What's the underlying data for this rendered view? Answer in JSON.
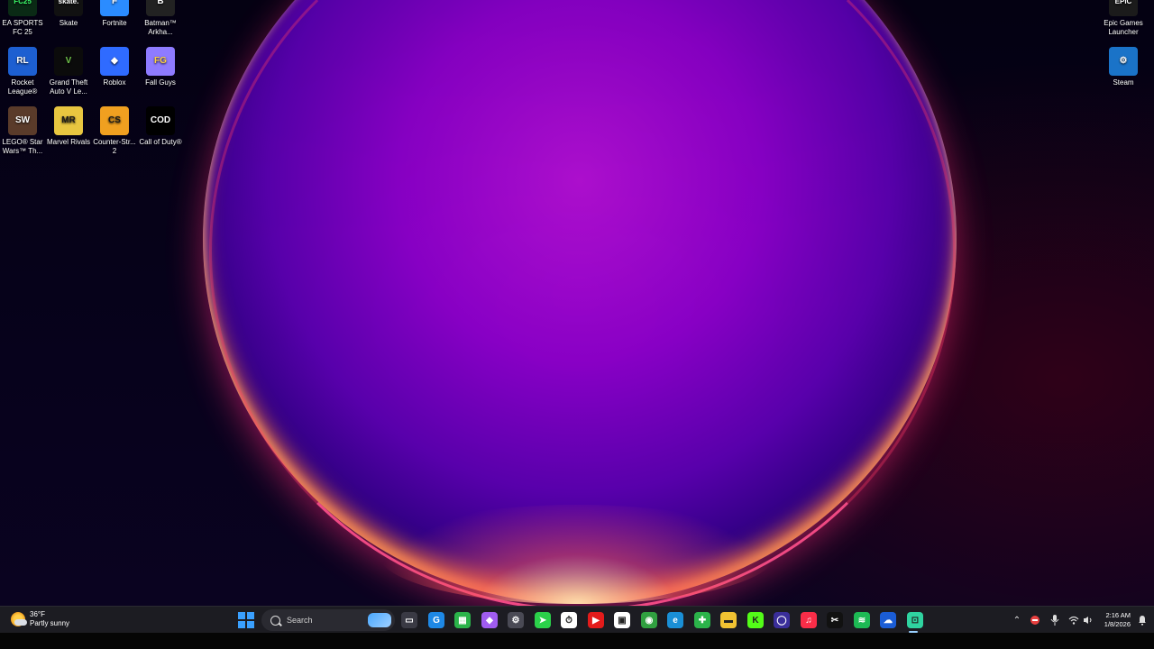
{
  "desktop_icons": [
    {
      "name": "ea-sports-fc-25",
      "label": "EA SPORTS FC 25",
      "art": "FC25",
      "bg": "#0a2a15",
      "fg": "#3cff6a"
    },
    {
      "name": "skate",
      "label": "Skate",
      "art": "skate.",
      "bg": "#111111",
      "fg": "#ffffff"
    },
    {
      "name": "fortnite",
      "label": "Fortnite",
      "art": "F",
      "bg": "#2b8cff",
      "fg": "#ffffff"
    },
    {
      "name": "batman-arkham",
      "label": "Batman™ Arkha...",
      "art": "B",
      "bg": "#222222",
      "fg": "#ffffff"
    },
    {
      "name": "rocket-league",
      "label": "Rocket League®",
      "art": "RL",
      "bg": "#1d5fd1",
      "fg": "#ffffff"
    },
    {
      "name": "gta-v",
      "label": "Grand Theft Auto V Le...",
      "art": "V",
      "bg": "#0b0b0b",
      "fg": "#6fc24a"
    },
    {
      "name": "roblox",
      "label": "Roblox",
      "art": "◆",
      "bg": "#2f6bff",
      "fg": "#ffffff"
    },
    {
      "name": "fall-guys",
      "label": "Fall Guys",
      "art": "FG",
      "bg": "#8e7bff",
      "fg": "#ffd23f"
    },
    {
      "name": "lego-star-wars",
      "label": "LEGO® Star Wars™ Th...",
      "art": "SW",
      "bg": "#5a3b2a",
      "fg": "#ffffff"
    },
    {
      "name": "marvel-rivals",
      "label": "Marvel Rivals",
      "art": "MR",
      "bg": "#e8c640",
      "fg": "#1a1a1a"
    },
    {
      "name": "counter-strike-2",
      "label": "Counter-Str... 2",
      "art": "CS",
      "bg": "#f0a020",
      "fg": "#1a1a1a"
    },
    {
      "name": "call-of-duty",
      "label": "Call of Duty®",
      "art": "COD",
      "bg": "#000000",
      "fg": "#ffffff"
    },
    {
      "name": "epic-games-launcher",
      "label": "Epic Games Launcher",
      "art": "EPIC",
      "bg": "#1b1b1b",
      "fg": "#ffffff"
    },
    {
      "name": "steam",
      "label": "Steam",
      "art": "⚙",
      "bg": "#1a73c8",
      "fg": "#ffffff"
    }
  ],
  "taskbar": {
    "weather": {
      "temp": "36°F",
      "condition": "Partly sunny"
    },
    "search_placeholder": "Search",
    "apps": [
      {
        "name": "task-view",
        "glyph": "▭",
        "bg": "#3a3a44"
      },
      {
        "name": "browser-g",
        "glyph": "G",
        "bg": "#1e88e5"
      },
      {
        "name": "app-green",
        "glyph": "▦",
        "bg": "#2bb34a"
      },
      {
        "name": "copilot",
        "glyph": "◆",
        "bg": "#a05cf0"
      },
      {
        "name": "settings",
        "glyph": "⚙",
        "bg": "#4a4a55"
      },
      {
        "name": "app-green-arrow",
        "glyph": "➤",
        "bg": "#2bd14a"
      },
      {
        "name": "stopwatch",
        "glyph": "⏱",
        "bg": "#ffffff"
      },
      {
        "name": "youtube",
        "glyph": "▶",
        "bg": "#e31b1b"
      },
      {
        "name": "store",
        "glyph": "▣",
        "bg": "#ffffff"
      },
      {
        "name": "chrome",
        "glyph": "◉",
        "bg": "#30a040"
      },
      {
        "name": "edge",
        "glyph": "e",
        "bg": "#1a8fd6"
      },
      {
        "name": "xbox",
        "glyph": "✚",
        "bg": "#2bb34a"
      },
      {
        "name": "file-explorer",
        "glyph": "▬",
        "bg": "#f1c232"
      },
      {
        "name": "kick",
        "glyph": "K",
        "bg": "#53fc18"
      },
      {
        "name": "app-circle",
        "glyph": "◯",
        "bg": "#3a2e9a"
      },
      {
        "name": "music",
        "glyph": "♫",
        "bg": "#fa2d48"
      },
      {
        "name": "capcut",
        "glyph": "✂",
        "bg": "#111111"
      },
      {
        "name": "spotify",
        "glyph": "≋",
        "bg": "#1db954"
      },
      {
        "name": "app-blue",
        "glyph": "☁",
        "bg": "#1b5dd6"
      },
      {
        "name": "app-active",
        "glyph": "⊡",
        "bg": "#2fd3a0"
      }
    ],
    "tray": {
      "time": "2:16 AM",
      "date": "1/8/2026"
    }
  }
}
